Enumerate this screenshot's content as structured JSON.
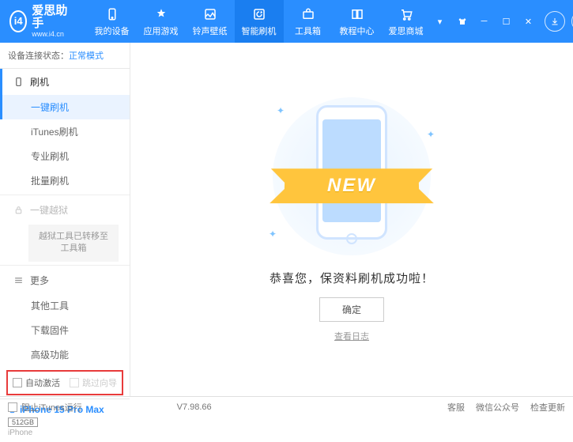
{
  "app": {
    "title": "爱思助手",
    "url": "www.i4.cn",
    "logo_letter": "i4"
  },
  "nav": [
    {
      "label": "我的设备"
    },
    {
      "label": "应用游戏"
    },
    {
      "label": "铃声壁纸"
    },
    {
      "label": "智能刷机"
    },
    {
      "label": "工具箱"
    },
    {
      "label": "教程中心"
    },
    {
      "label": "爱思商城"
    }
  ],
  "status": {
    "label": "设备连接状态：",
    "value": "正常模式"
  },
  "sections": {
    "flash": {
      "title": "刷机",
      "items": [
        "一键刷机",
        "iTunes刷机",
        "专业刷机",
        "批量刷机"
      ]
    },
    "jailbreak": {
      "title": "一键越狱",
      "note": "越狱工具已转移至工具箱"
    },
    "more": {
      "title": "更多",
      "items": [
        "其他工具",
        "下载固件",
        "高级功能"
      ]
    }
  },
  "checkboxes": {
    "auto_activate": "自动激活",
    "skip_guide": "跳过向导"
  },
  "device": {
    "name": "iPhone 15 Pro Max",
    "storage": "512GB",
    "type": "iPhone"
  },
  "main": {
    "banner": "NEW",
    "success": "恭喜您，保资料刷机成功啦！",
    "ok": "确定",
    "log": "查看日志"
  },
  "footer": {
    "block_itunes": "阻止iTunes运行",
    "version": "V7.98.66",
    "links": [
      "客服",
      "微信公众号",
      "检查更新"
    ]
  }
}
